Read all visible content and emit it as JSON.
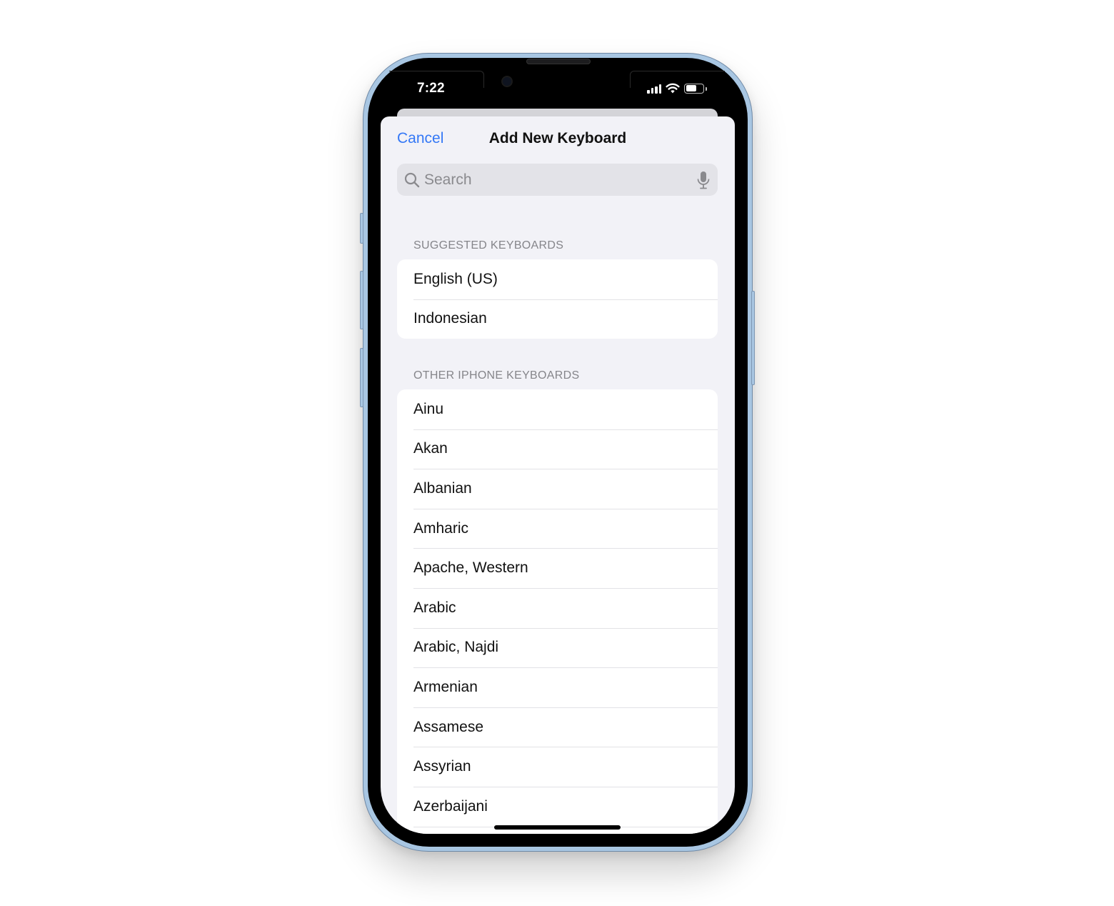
{
  "status_bar": {
    "time": "7:22",
    "icons": [
      "cellular-signal-icon",
      "wifi-icon",
      "battery-icon"
    ],
    "battery_level": 0.65
  },
  "nav": {
    "cancel_label": "Cancel",
    "title": "Add New Keyboard"
  },
  "search": {
    "placeholder": "Search",
    "value": "",
    "icon": "magnifying-glass-icon",
    "mic_icon": "microphone-icon"
  },
  "sections": [
    {
      "header": "SUGGESTED KEYBOARDS",
      "items": [
        "English (US)",
        "Indonesian"
      ]
    },
    {
      "header": "OTHER IPHONE KEYBOARDS",
      "items": [
        "Ainu",
        "Akan",
        "Albanian",
        "Amharic",
        "Apache, Western",
        "Arabic",
        "Arabic, Najdi",
        "Armenian",
        "Assamese",
        "Assyrian",
        "Azerbaijani"
      ]
    }
  ],
  "colors": {
    "accent": "#3478f6",
    "background": "#f2f2f7",
    "phone_frame": "#a8c6e2"
  }
}
